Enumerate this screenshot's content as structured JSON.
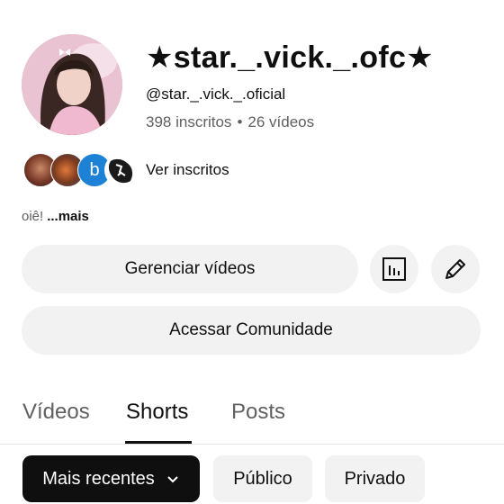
{
  "channel": {
    "name": "★star._.vick._.ofc★",
    "handle": "@star._.vick._.oficial",
    "subscribers": "398 inscritos",
    "separator": "•",
    "videos": "26 vídeos"
  },
  "subscribers_row": {
    "third_avatar_letter": "b",
    "link_label": "Ver inscritos"
  },
  "description": {
    "text": "oiê!",
    "more": "...mais"
  },
  "actions": {
    "manage_videos": "Gerenciar vídeos",
    "access_community": "Acessar Comunidade",
    "stats_icon": "analytics-icon",
    "edit_icon": "pencil-icon"
  },
  "tabs": [
    {
      "label": "Vídeos",
      "selected": false
    },
    {
      "label": "Shorts",
      "selected": true
    },
    {
      "label": "Posts",
      "selected": false
    }
  ],
  "filters": [
    {
      "label": "Mais recentes",
      "selected": true,
      "icon": "chevron-down-icon"
    },
    {
      "label": "Público",
      "selected": false
    },
    {
      "label": "Privado",
      "selected": false
    }
  ],
  "colors": {
    "text_primary": "#0f0f0f",
    "text_secondary": "#606060",
    "chip_bg": "#f2f2f2",
    "chip_selected_bg": "#0f0f0f",
    "badge_blue": "#1d82d6"
  }
}
